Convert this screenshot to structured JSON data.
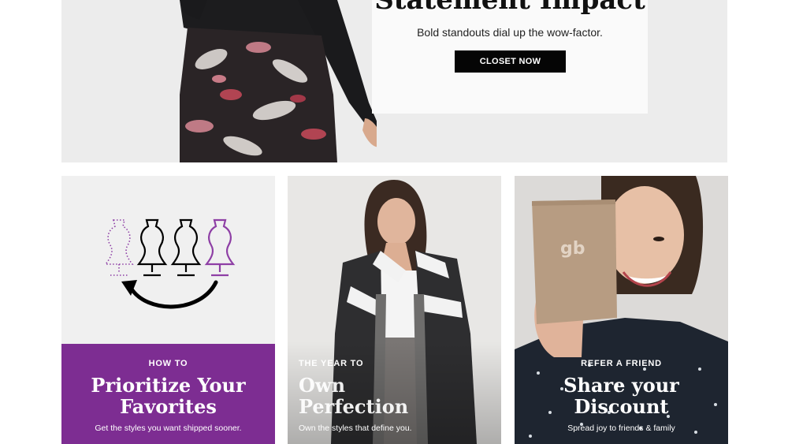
{
  "hero": {
    "title": "Statement Impact",
    "subtitle": "Bold standouts dial up the wow-factor.",
    "cta_label": "CLOSET NOW"
  },
  "tiles": [
    {
      "eyebrow": "HOW TO",
      "headline_line1": "Prioritize Your",
      "headline_line2": "Favorites",
      "description": "Get the styles you want shipped sooner."
    },
    {
      "eyebrow": "THE YEAR TO",
      "headline_line1": "Own",
      "headline_line2": "Perfection",
      "description": "Own the styles that define you."
    },
    {
      "eyebrow": "REFER A FRIEND",
      "headline_line1": "Share your",
      "headline_line2": "Discount",
      "description": "Spread joy to friends & family",
      "card_logo": "gb"
    }
  ],
  "colors": {
    "brand_purple": "#7d2d92",
    "cta_black": "#050505"
  }
}
